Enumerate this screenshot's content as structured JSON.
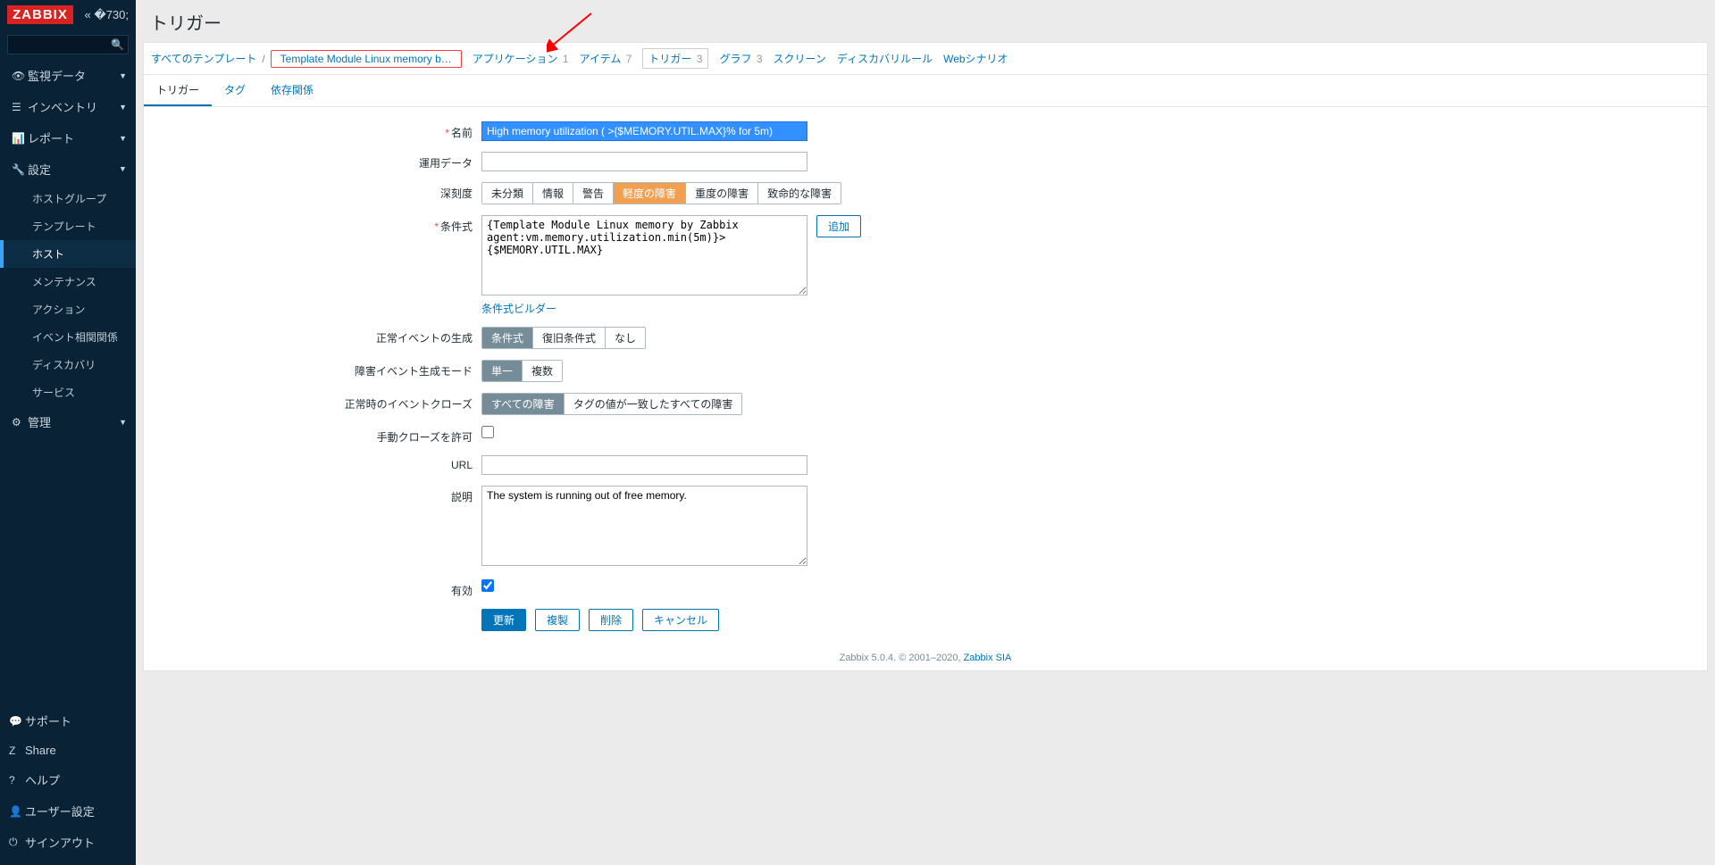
{
  "logo": "ZABBIX",
  "search": {
    "placeholder": ""
  },
  "nav": {
    "monitoring": "監視データ",
    "inventory": "インベントリ",
    "reports": "レポート",
    "config": "設定",
    "config_items": {
      "hostgroups": "ホストグループ",
      "templates": "テンプレート",
      "hosts": "ホスト",
      "maintenance": "メンテナンス",
      "actions": "アクション",
      "correlation": "イベント相関関係",
      "discovery": "ディスカバリ",
      "services": "サービス"
    },
    "admin": "管理"
  },
  "bottom_nav": {
    "support": "サポート",
    "share": "Share",
    "help": "ヘルプ",
    "user": "ユーザー設定",
    "signout": "サインアウト"
  },
  "page": {
    "title": "トリガー"
  },
  "breadcrumb": {
    "all_templates": "すべてのテンプレート",
    "template": "Template Module Linux memory b…",
    "applications": "アプリケーション",
    "applications_count": "1",
    "items": "アイテム",
    "items_count": "7",
    "triggers": "トリガー",
    "triggers_count": "3",
    "graphs": "グラフ",
    "graphs_count": "3",
    "screens": "スクリーン",
    "discovery": "ディスカバリルール",
    "web": "Webシナリオ"
  },
  "tabs": {
    "trigger": "トリガー",
    "tags": "タグ",
    "deps": "依存関係"
  },
  "form": {
    "name_label": "名前",
    "name_value": "High memory utilization ( >{$MEMORY.UTIL.MAX}% for 5m)",
    "opdata_label": "運用データ",
    "opdata_value": "",
    "severity_label": "深刻度",
    "severity": {
      "not_classified": "未分類",
      "info": "情報",
      "warning": "警告",
      "average": "軽度の障害",
      "high": "重度の障害",
      "disaster": "致命的な障害"
    },
    "expr_label": "条件式",
    "expr_value": "{Template Module Linux memory by Zabbix agent:vm.memory.utilization.min(5m)}>{$MEMORY.UTIL.MAX}",
    "expr_add": "追加",
    "expr_builder": "条件式ビルダー",
    "ok_event_label": "正常イベントの生成",
    "ok_event": {
      "expr": "条件式",
      "recovery": "復旧条件式",
      "none": "なし"
    },
    "problem_mode_label": "障害イベント生成モード",
    "problem_mode": {
      "single": "単一",
      "multiple": "複数"
    },
    "ok_close_label": "正常時のイベントクローズ",
    "ok_close": {
      "all": "すべての障害",
      "tags": "タグの値が一致したすべての障害"
    },
    "manual_close_label": "手動クローズを許可",
    "url_label": "URL",
    "url_value": "",
    "desc_label": "説明",
    "desc_value": "The system is running out of free memory.",
    "enabled_label": "有効"
  },
  "buttons": {
    "update": "更新",
    "clone": "複製",
    "delete": "削除",
    "cancel": "キャンセル"
  },
  "footer": {
    "text": "Zabbix 5.0.4. © 2001–2020, ",
    "link": "Zabbix SIA"
  }
}
